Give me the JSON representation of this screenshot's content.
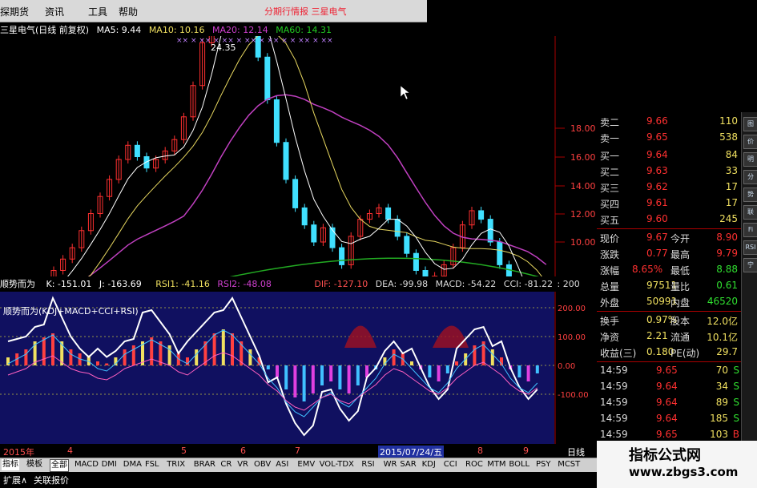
{
  "menu": {
    "items": [
      "探期货",
      "资讯",
      "工具",
      "帮助"
    ],
    "banner": "分期行情报  三星电气"
  },
  "chart": {
    "stock_name": "三星电气(日线 前复权)",
    "ma5": "MA5: 9.44",
    "ma10": "MA10: 10.16",
    "ma20": "MA20: 12.14",
    "ma60": "MA60: 14.31",
    "high_label": "24.35",
    "y_ticks": [
      "18.00",
      "16.00",
      "14.00",
      "12.00",
      "10.00"
    ],
    "colors": {
      "ma5": "#ffffff",
      "ma10": "#f0e060",
      "ma20": "#d040d0",
      "ma60": "#22aa22",
      "up": "#ff3030",
      "down": "#40e0ff"
    }
  },
  "indicator": {
    "name": "顺势而为",
    "k": "K: -151.01",
    "j": "J: -163.69",
    "rsi1": "RSI1: -41.16",
    "rsi2": "RSI2: -48.08",
    "dif": "DIF: -127.10",
    "dea": "DEA: -99.98",
    "macd": "MACD: -54.22",
    "cci": "CCI: -81.22",
    "tail": ": 200",
    "sub_label": "顺势而为(KDJ+MACD+CCI+RSI)",
    "y_ticks": [
      "200.00",
      "100.00",
      "0.00",
      "-100.00"
    ]
  },
  "date_axis": {
    "labels": [
      "2015年",
      "4",
      "5",
      "6",
      "7",
      "2015/07/24/五",
      "8",
      "9"
    ],
    "right": "日线"
  },
  "quote": {
    "rows": [
      {
        "label": "卖二",
        "price": "9.66",
        "vol": "110"
      },
      {
        "label": "卖一",
        "price": "9.65",
        "vol": "538"
      },
      {
        "label": "买一",
        "price": "9.64",
        "vol": "84"
      },
      {
        "label": "买二",
        "price": "9.63",
        "vol": "33"
      },
      {
        "label": "买三",
        "price": "9.62",
        "vol": "17"
      },
      {
        "label": "买四",
        "price": "9.61",
        "vol": "17"
      },
      {
        "label": "买五",
        "price": "9.60",
        "vol": "245"
      }
    ],
    "stats": [
      {
        "l1": "现价",
        "v1": "9.67",
        "l2": "今开",
        "v2": "8.90"
      },
      {
        "l1": "涨跌",
        "v1": "0.77",
        "l2": "最高",
        "v2": "9.79"
      },
      {
        "l1": "涨幅",
        "v1": "8.65%",
        "l2": "最低",
        "v2": "8.88"
      },
      {
        "l1": "总量",
        "v1": "97511",
        "l2": "量比",
        "v2": "0.61"
      },
      {
        "l1": "外盘",
        "v1": "50991",
        "l2": "内盘",
        "v2": "46520"
      },
      {
        "l1": "换手",
        "v1": "0.97%",
        "l2": "股本",
        "v2": "12.0亿"
      },
      {
        "l1": "净资",
        "v1": "2.21",
        "l2": "流通",
        "v2": "10.1亿"
      },
      {
        "l1": "收益(三)",
        "v1": "0.180",
        "l2": "PE(动)",
        "v2": "29.7"
      }
    ],
    "ticks": [
      {
        "time": "14:59",
        "price": "9.65",
        "vol": "70",
        "flag": "S"
      },
      {
        "time": "14:59",
        "price": "9.64",
        "vol": "34",
        "flag": "S"
      },
      {
        "time": "14:59",
        "price": "9.64",
        "vol": "89",
        "flag": "S"
      },
      {
        "time": "14:59",
        "price": "9.64",
        "vol": "185",
        "flag": "S"
      },
      {
        "time": "14:59",
        "price": "9.65",
        "vol": "103",
        "flag": "B"
      }
    ]
  },
  "sidebar": [
    "图",
    "价",
    "明",
    "分",
    "势",
    "联",
    "Fi",
    "RSI",
    "宁"
  ],
  "tabs": [
    "指标",
    "模板",
    "全部",
    "MACD",
    "DMI",
    "DMA",
    "FSL",
    "TRIX",
    "BRAR",
    "CR",
    "VR",
    "OBV",
    "ASI",
    "EMV",
    "VOL-TDX",
    "RSI",
    "WR",
    "SAR",
    "KDJ",
    "CCI",
    "ROC",
    "MTM",
    "BOLL",
    "PSY",
    "MCST"
  ],
  "bottom": {
    "expand": "扩展∧",
    "related": "关联报价"
  },
  "watermark": {
    "title": "指标公式网",
    "url": "www.zbgs3.com"
  }
}
